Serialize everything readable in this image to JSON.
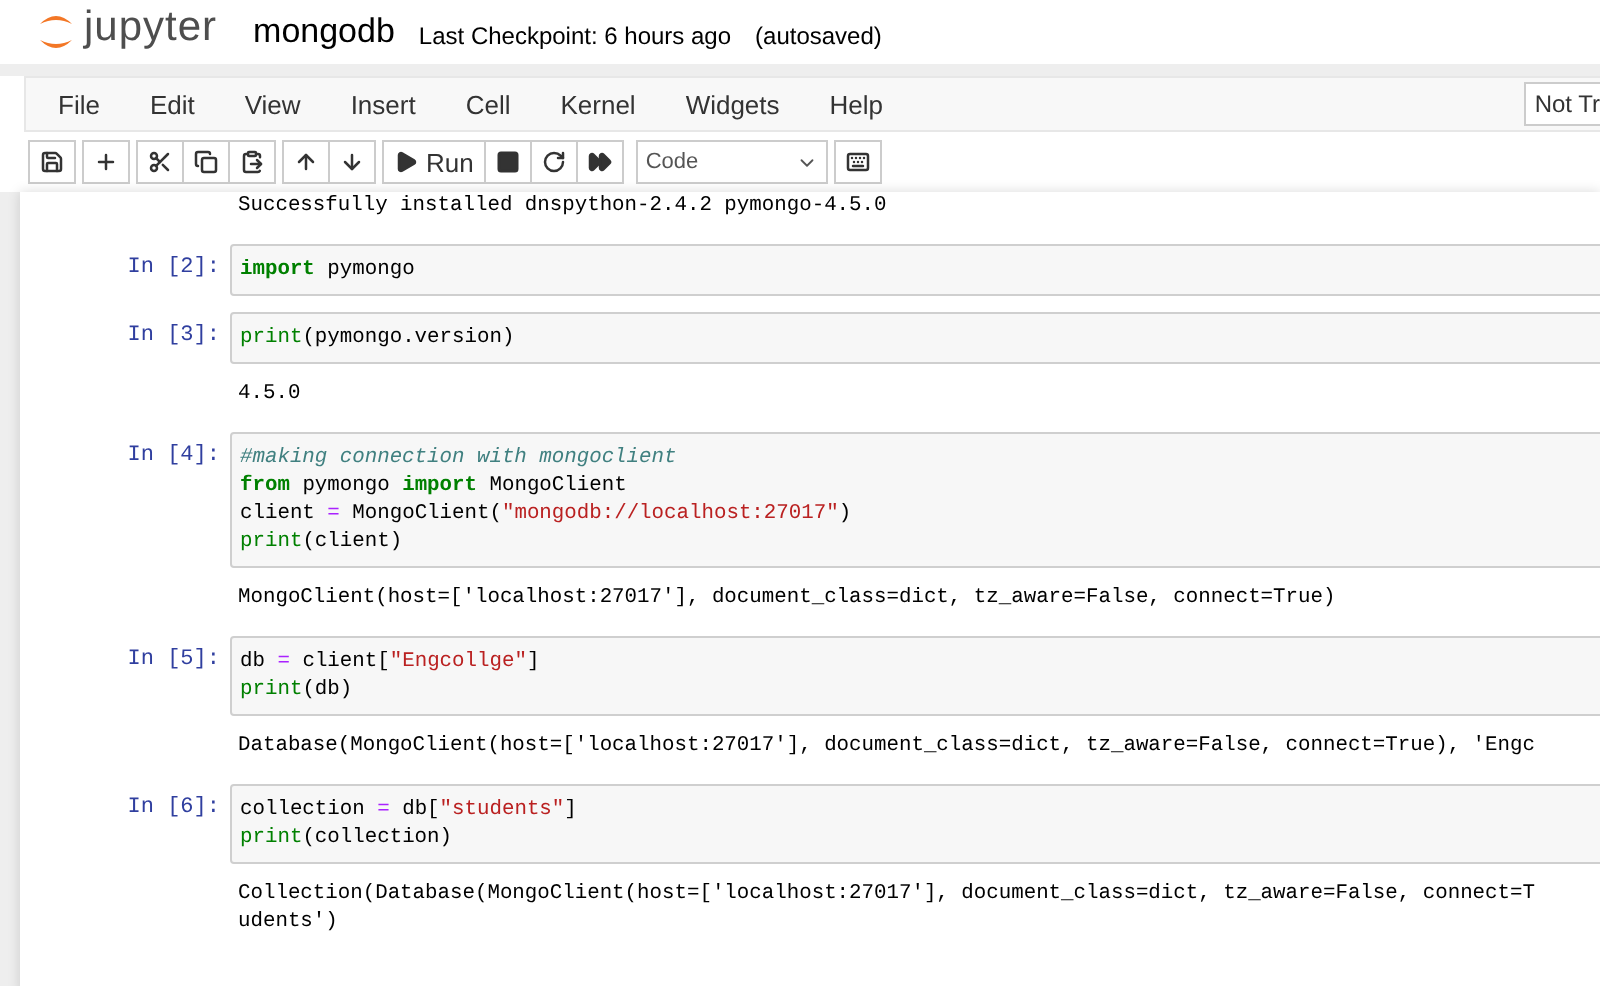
{
  "header": {
    "logo_text": "jupyter",
    "notebook_name": "mongodb",
    "checkpoint": "Last Checkpoint: 6 hours ago",
    "save_status": "(autosaved)"
  },
  "menu": [
    "File",
    "Edit",
    "View",
    "Insert",
    "Cell",
    "Kernel",
    "Widgets",
    "Help"
  ],
  "kernel_indicator": "Not Tr",
  "toolbar": [
    {
      "kind": "save"
    },
    {
      "kind": "add"
    },
    {
      "kind": "cut"
    },
    {
      "kind": "copy"
    },
    {
      "kind": "paste"
    },
    {
      "kind": "up"
    },
    {
      "kind": "down"
    },
    {
      "kind": "run",
      "label": "Run"
    },
    {
      "kind": "stop"
    },
    {
      "kind": "restart"
    },
    {
      "kind": "runall"
    },
    {
      "kind": "select",
      "label": "Code"
    },
    {
      "kind": "keyboard"
    }
  ],
  "cells": [
    {
      "output": [
        "Successfully installed dnspython-2.4.2 pymongo-4.5.0"
      ]
    },
    {
      "prompt": "In [2]:",
      "code": [
        [
          {
            "kind": "keyword",
            "text": "import"
          },
          {
            "kind": "plain",
            "text": " pymongo"
          }
        ]
      ]
    },
    {
      "prompt": "In [3]:",
      "code": [
        [
          {
            "kind": "builtin",
            "text": "print"
          },
          {
            "kind": "plain",
            "text": "(pymongo.version)"
          }
        ]
      ],
      "output": [
        "4.5.0"
      ]
    },
    {
      "prompt": "In [4]:",
      "code": [
        [
          {
            "kind": "comment",
            "text": "#making connection with mongoclient"
          }
        ],
        [
          {
            "kind": "keyword",
            "text": "from"
          },
          {
            "kind": "plain",
            "text": " pymongo "
          },
          {
            "kind": "keyword",
            "text": "import"
          },
          {
            "kind": "plain",
            "text": " MongoClient"
          }
        ],
        [
          {
            "kind": "plain",
            "text": "client "
          },
          {
            "kind": "operator",
            "text": "="
          },
          {
            "kind": "plain",
            "text": " MongoClient("
          },
          {
            "kind": "string",
            "text": "\"mongodb://localhost:27017\""
          },
          {
            "kind": "plain",
            "text": ")"
          }
        ],
        [
          {
            "kind": "builtin",
            "text": "print"
          },
          {
            "kind": "plain",
            "text": "(client)"
          }
        ]
      ],
      "output": [
        "MongoClient(host=['localhost:27017'], document_class=dict, tz_aware=False, connect=True)"
      ]
    },
    {
      "prompt": "In [5]:",
      "code": [
        [
          {
            "kind": "plain",
            "text": "db "
          },
          {
            "kind": "operator",
            "text": "="
          },
          {
            "kind": "plain",
            "text": " client["
          },
          {
            "kind": "string",
            "text": "\"Engcollge\""
          },
          {
            "kind": "plain",
            "text": "]"
          }
        ],
        [
          {
            "kind": "builtin",
            "text": "print"
          },
          {
            "kind": "plain",
            "text": "(db)"
          }
        ]
      ],
      "output": [
        "Database(MongoClient(host=['localhost:27017'], document_class=dict, tz_aware=False, connect=True), 'Engc"
      ]
    },
    {
      "prompt": "In [6]:",
      "code": [
        [
          {
            "kind": "plain",
            "text": "collection "
          },
          {
            "kind": "operator",
            "text": "="
          },
          {
            "kind": "plain",
            "text": " db["
          },
          {
            "kind": "string",
            "text": "\"students\""
          },
          {
            "kind": "plain",
            "text": "]"
          }
        ],
        [
          {
            "kind": "builtin",
            "text": "print"
          },
          {
            "kind": "plain",
            "text": "(collection)"
          }
        ]
      ],
      "output": [
        "Collection(Database(MongoClient(host=['localhost:27017'], document_class=dict, tz_aware=False, connect=T",
        "udents')"
      ]
    }
  ]
}
